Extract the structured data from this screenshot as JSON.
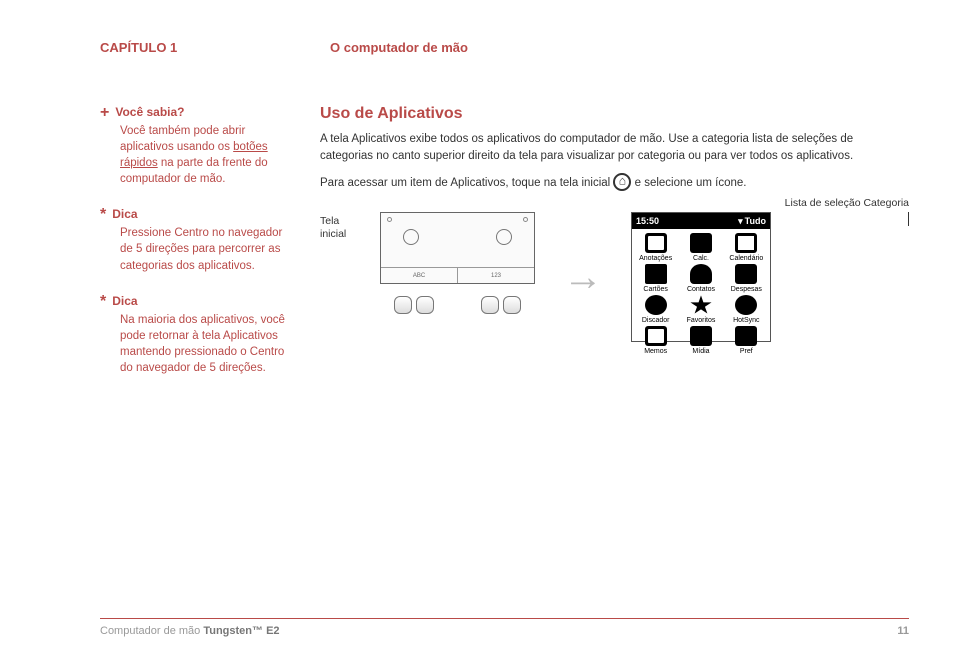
{
  "header": {
    "chapter": "CAPÍTULO 1",
    "title": "O computador de mão"
  },
  "sidebar": {
    "did_you_know": {
      "icon": "+",
      "title": "Você sabia?",
      "body_pre": "Você também pode abrir aplicativos usando os ",
      "link": "botões rápidos",
      "body_post": " na parte da frente do computador de mão."
    },
    "tip1": {
      "icon": "*",
      "title": "Dica",
      "body": "Pressione Centro no navegador de 5 direções para percorrer as categorias dos aplicativos."
    },
    "tip2": {
      "icon": "*",
      "title": "Dica",
      "body": "Na maioria dos aplicativos, você pode retornar à tela Aplicativos mantendo pressionado o Centro do navegador de 5 direções."
    }
  },
  "main": {
    "section_title": "Uso de Aplicativos",
    "para1": "A tela Aplicativos exibe todos os aplicativos do computador de mão. Use a categoria lista de seleções de categorias no canto superior direito da tela para visualizar por categoria ou para ver todos os aplicativos.",
    "para2_pre": "Para acessar um item de Aplicativos, toque na tela inicial ",
    "para2_post": " e selecione um ícone.",
    "caption_right": "Lista de seleção Categoria",
    "fig_label": "Tela inicial",
    "abc": "ABC",
    "num": "123"
  },
  "palm_screen": {
    "time": "15:50",
    "dropdown": "Tudo",
    "items": [
      "Anotações",
      "Calc.",
      "Calendário",
      "Cartões",
      "Contatos",
      "Despesas",
      "Discador",
      "Favoritos",
      "HotSync",
      "Memos",
      "Mídia",
      "Pref"
    ]
  },
  "footer": {
    "text_pre": "Computador de mão ",
    "text_bold": "Tungsten™ E2",
    "page": "11"
  }
}
